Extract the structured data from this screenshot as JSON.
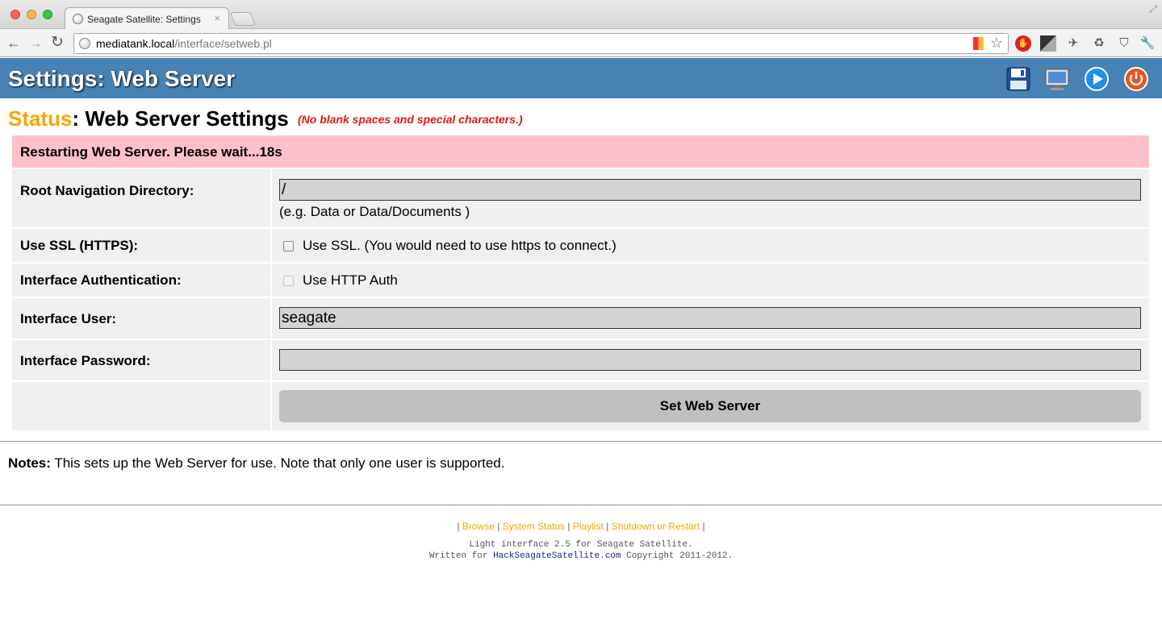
{
  "browser": {
    "tab_title": "Seagate Satellite: Settings",
    "tab_close": "×",
    "url_host": "mediatank.local",
    "url_path": "/interface/setweb.pl"
  },
  "header": {
    "title": "Settings: Web Server",
    "background": "#4682b4",
    "icons": [
      "save-icon",
      "monitor-icon",
      "play-icon",
      "power-icon"
    ]
  },
  "status": {
    "label": "Status",
    "colon": ":",
    "title": " Web Server Settings",
    "hint": "(No blank spaces and special characters.)",
    "label_color": "#f5a700",
    "hint_color": "#e0170f"
  },
  "alert": {
    "message": "Restarting Web Server. Please wait...18s",
    "background": "#ffc0cb"
  },
  "form": {
    "root_dir": {
      "label": "Root Navigation Directory:",
      "value": "/",
      "hint": "(e.g. Data or Data/Documents )"
    },
    "ssl": {
      "label": "Use SSL (HTTPS):",
      "checkbox_label": "Use SSL. (You would need to use https to connect.)",
      "checked": false
    },
    "auth": {
      "label": "Interface Authentication:",
      "checkbox_label": "Use HTTP Auth",
      "checked": false,
      "disabled": true
    },
    "user": {
      "label": "Interface User:",
      "value": "seagate"
    },
    "password": {
      "label": "Interface Password:",
      "value": ""
    },
    "submit_label": "Set Web Server"
  },
  "notes": {
    "label": "Notes:",
    "text": " This sets up the Web Server for use. Note that only one user is supported."
  },
  "footer": {
    "sep": "|",
    "links": [
      "Browse",
      "System Status",
      "Playlist",
      "Shutdown or Restart"
    ],
    "link_color": "#f5a700",
    "credit_line1": "Light interface 2.5 for Seagate Satellite.",
    "credit_prefix": "Written for ",
    "credit_link": "HackSeagateSatellite.com",
    "credit_suffix": " Copyright 2011-2012."
  }
}
